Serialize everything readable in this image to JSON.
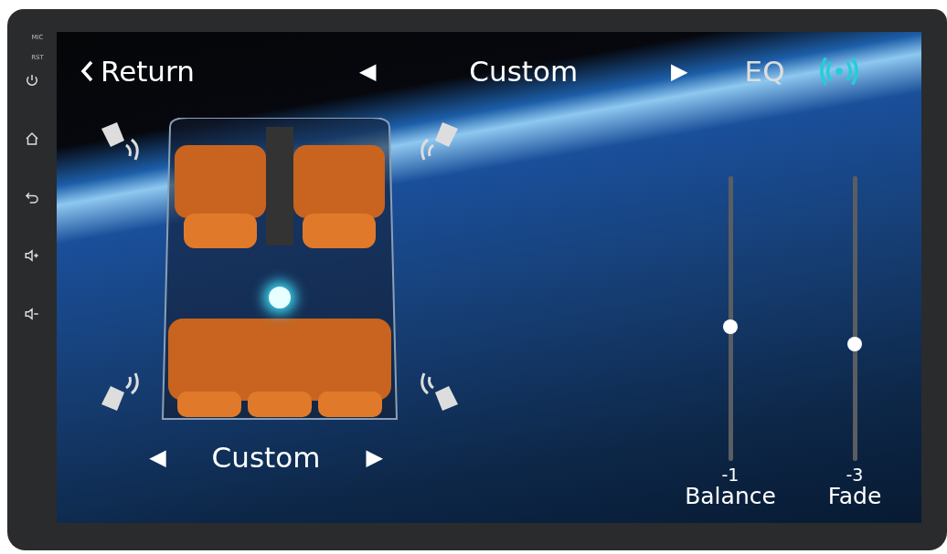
{
  "bezel": {
    "labels": [
      "MIC",
      "RST"
    ]
  },
  "top_bar": {
    "back": "Return",
    "prev": "◀",
    "preset": "Custom",
    "next": "▶",
    "eq": "EQ"
  },
  "seat_preset": {
    "prev": "◀",
    "label": "Custom",
    "next": "▶"
  },
  "sliders": [
    {
      "value": "-1",
      "label": "Balance",
      "level": 0.47
    },
    {
      "value": "-3",
      "label": "Fade",
      "level": 0.41
    }
  ]
}
